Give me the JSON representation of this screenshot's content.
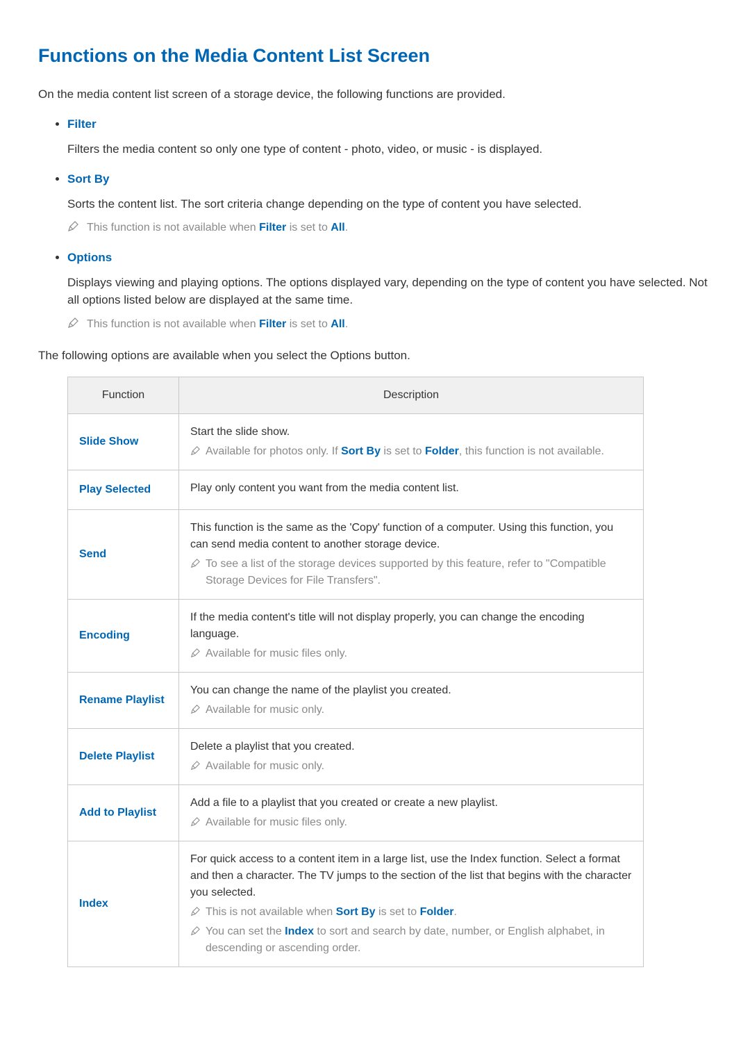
{
  "heading": "Functions on the Media Content List Screen",
  "intro": "On the media content list screen of a storage device, the following functions are provided.",
  "bullets": {
    "filter": {
      "title": "Filter",
      "desc": "Filters the media content so only one type of content - photo, video, or music - is displayed."
    },
    "sortby": {
      "title": "Sort By",
      "desc": "Sorts the content list. The sort criteria change depending on the type of content you have selected.",
      "note_pre": "This function is not available when ",
      "note_bold1": "Filter",
      "note_mid": " is set to ",
      "note_bold2": "All",
      "note_post": "."
    },
    "options": {
      "title": "Options",
      "desc": "Displays viewing and playing options. The options displayed vary, depending on the type of content you have selected. Not all options listed below are displayed at the same time.",
      "note_pre": "This function is not available when ",
      "note_bold1": "Filter",
      "note_mid": " is set to ",
      "note_bold2": "All",
      "note_post": "."
    }
  },
  "below": "The following options are available when you select the Options button.",
  "table": {
    "header_function": "Function",
    "header_description": "Description",
    "rows": {
      "slideshow": {
        "name": "Slide Show",
        "desc": "Start the slide show.",
        "note_pre": "Available for photos only. If ",
        "note_b1": "Sort By",
        "note_mid": " is set to ",
        "note_b2": "Folder",
        "note_post": ", this function is not available."
      },
      "playselected": {
        "name": "Play Selected",
        "desc": "Play only content you want from the media content list."
      },
      "send": {
        "name": "Send",
        "desc": "This function is the same as the 'Copy' function of a computer. Using this function, you can send media content to another storage device.",
        "note": "To see a list of the storage devices supported by this feature, refer to \"Compatible Storage Devices for File Transfers\"."
      },
      "encoding": {
        "name": "Encoding",
        "desc": "If the media content's title will not display properly, you can change the encoding language.",
        "note": "Available for music files only."
      },
      "rename": {
        "name": "Rename Playlist",
        "desc": "You can change the name of the playlist you created.",
        "note": "Available for music only."
      },
      "delete": {
        "name": "Delete Playlist",
        "desc": "Delete a playlist that you created.",
        "note": "Available for music only."
      },
      "addto": {
        "name": "Add to Playlist",
        "desc": "Add a file to a playlist that you created or create a new playlist.",
        "note": "Available for music files only."
      },
      "index": {
        "name": "Index",
        "desc": "For quick access to a content item in a large list, use the Index function. Select a format and then a character. The TV jumps to the section of the list that begins with the character you selected.",
        "note1_pre": "This is not available when ",
        "note1_b1": "Sort By",
        "note1_mid": " is set to ",
        "note1_b2": "Folder",
        "note1_post": ".",
        "note2_pre": "You can set the ",
        "note2_b1": "Index",
        "note2_post": " to sort and search by date, number, or English alphabet, in descending or ascending order."
      }
    }
  }
}
